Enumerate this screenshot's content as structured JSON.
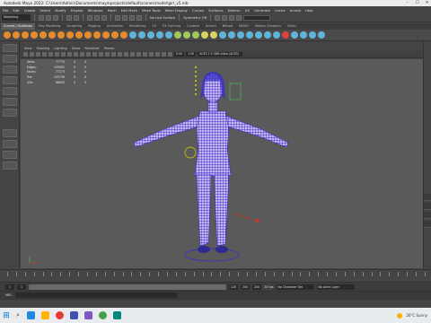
{
  "window": {
    "title": "Autodesk Maya 2022: C:\\Users\\Admin\\Documents\\maya\\projects\\default\\scenes\\model\\girl_v5.mb",
    "controls": [
      "–",
      "☐",
      "✕"
    ]
  },
  "menubar": {
    "items": [
      "File",
      "Edit",
      "Create",
      "Select",
      "Modify",
      "Display",
      "Windows",
      "Mesh",
      "Edit Mesh",
      "Mesh Tools",
      "Mesh Display",
      "Curves",
      "Surfaces",
      "Deform",
      "UV",
      "Generate",
      "Cache",
      "Arnold",
      "Help"
    ]
  },
  "statusline": {
    "mode": "Modeling",
    "no_live_surface": "No Live Surface",
    "symmetry": "Symmetry: Off"
  },
  "shelf_tabs": [
    "Curves / Surfaces",
    "Poly Modeling",
    "Sculpting",
    "Rigging",
    "Animation",
    "Rendering",
    "FX",
    "FX Caching",
    "Custom",
    "Arnold",
    "Bifrost",
    "MASH",
    "Motion Graphics",
    "XGen"
  ],
  "shelf_active_tab_index": 0,
  "shelf_icon_colors": [
    "#e68a2e",
    "#e68a2e",
    "#e68a2e",
    "#e68a2e",
    "#e68a2e",
    "#e68a2e",
    "#e68a2e",
    "#e68a2e",
    "#e68a2e",
    "#e68a2e",
    "#e68a2e",
    "#e68a2e",
    "#e68a2e",
    "#e68a2e",
    "#5fb4d9",
    "#5fb4d9",
    "#5fb4d9",
    "#5fb4d9",
    "#5fb4d9",
    "#9ccb5a",
    "#9ccb5a",
    "#9ccb5a",
    "#d9d35f",
    "#d9d35f",
    "#5fb4d9",
    "#5fb4d9",
    "#5fb4d9",
    "#5fb4d9",
    "#5fb4d9",
    "#5fb4d9",
    "#5fb4d9",
    "#e04040",
    "#5fb4d9",
    "#5fb4d9",
    "#5fb4d9",
    "#5fb4d9"
  ],
  "panel_menu": [
    "View",
    "Shading",
    "Lighting",
    "Show",
    "Renderer",
    "Panels"
  ],
  "panel_toolbar": {
    "near_value": "0.00",
    "far_value": "1.00",
    "colorspace": "ACES 1.0 SDR-video (ACES)"
  },
  "hud": {
    "rows": [
      {
        "label": "Verts:",
        "value": "77770",
        "z1": "0",
        "z2": "0"
      },
      {
        "label": "Edges:",
        "value": "155092",
        "z1": "0",
        "z2": "0"
      },
      {
        "label": "Faces:",
        "value": "77273",
        "z1": "0",
        "z2": "0"
      },
      {
        "label": "Tris:",
        "value": "153739",
        "z1": "0",
        "z2": "0"
      },
      {
        "label": "UVs:",
        "value": "86843",
        "z1": "0",
        "z2": "0"
      }
    ]
  },
  "model_colors": {
    "wire": "#3a30c8",
    "wire_light": "#c7b6f0",
    "accent_green": "#4caf50",
    "accent_yellow": "#e7d300",
    "accent_red": "#c0392b"
  },
  "rangeslider": {
    "start": "1",
    "end": "120",
    "start2": "200",
    "end2": "200",
    "character_set": "No Character Set",
    "anim_layer": "No Anim Layer",
    "fps": "24 fps"
  },
  "commandline": {
    "label": "MEL"
  },
  "taskbar": {
    "weather": "26°C Sunny",
    "apps": [
      "#1e88e5",
      "#ffb300",
      "#e53935",
      "#3f51b5",
      "#7e57c2",
      "#43a047",
      "#00897b"
    ]
  }
}
